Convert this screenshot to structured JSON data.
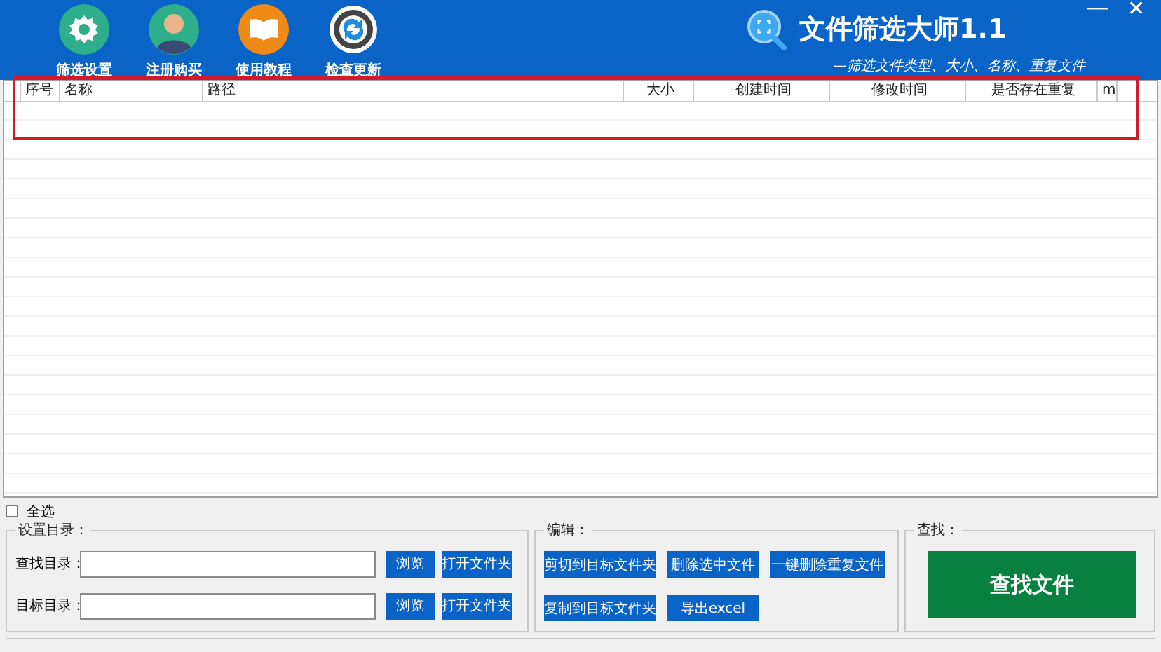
{
  "toolbar": [
    {
      "kind": "settings",
      "label": "筛选设置"
    },
    {
      "kind": "register",
      "label": "注册购买"
    },
    {
      "kind": "tutorial",
      "label": "使用教程"
    },
    {
      "kind": "update",
      "label": "检查更新"
    }
  ],
  "app": {
    "title": "文件筛选大师1.1",
    "subtitle": "—筛选文件类型、大小、名称、重复文件",
    "minimize": "—",
    "close": "✕"
  },
  "table": {
    "columns": [
      "序号",
      "名称",
      "路径",
      "大小",
      "创建时间",
      "修改时间",
      "是否存在重复",
      "m"
    ]
  },
  "select_all": {
    "label": "全选",
    "checked": false
  },
  "directories": {
    "legend": "设置目录：",
    "rows": [
      {
        "label": "查找目录：",
        "browse": "浏览",
        "open": "打开文件夹"
      },
      {
        "label": "目标目录：",
        "browse": "浏览",
        "open": "打开文件夹"
      }
    ]
  },
  "edit": {
    "legend": "编辑：",
    "buttons": [
      "剪切到目标文件夹",
      "删除选中文件",
      "一键删除重复文件",
      "复制到目标文件夹",
      "导出excel"
    ]
  },
  "find": {
    "legend": "查找：",
    "button": "查找文件"
  }
}
